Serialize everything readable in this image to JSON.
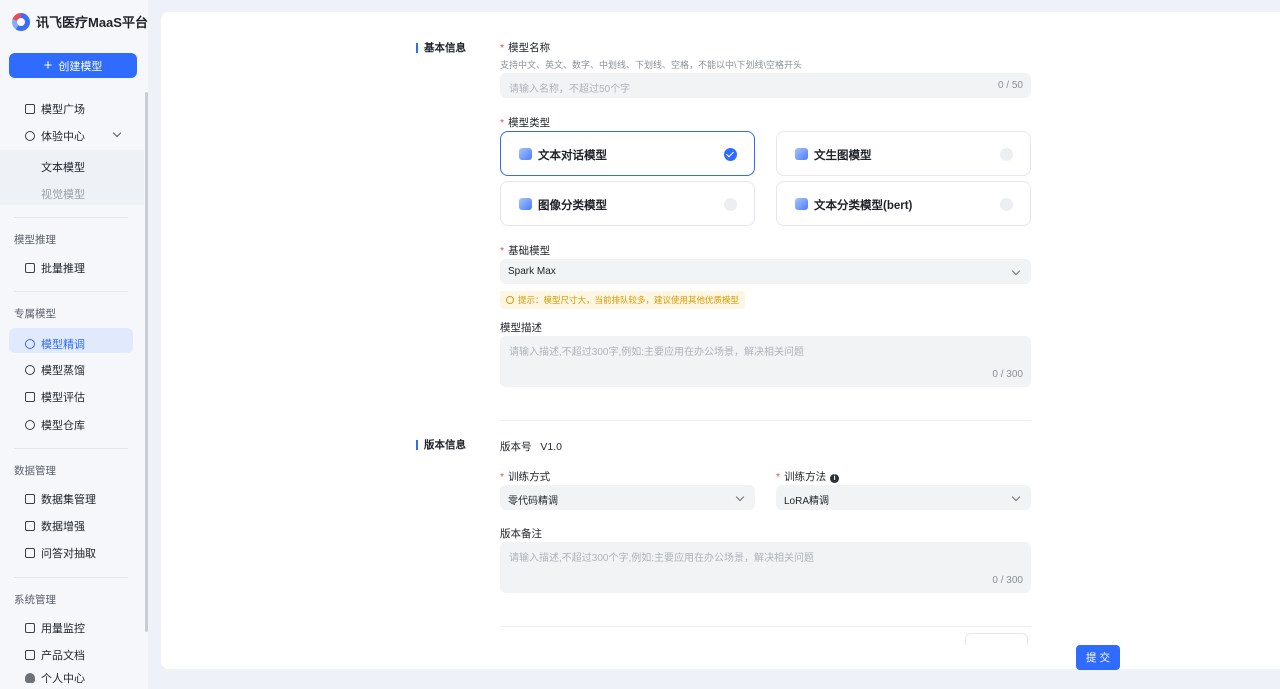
{
  "app": {
    "title": "讯飞医疗MaaS平台"
  },
  "sidebar": {
    "create_button": "创建模型",
    "items": {
      "model_square": "模型广场",
      "experience_center": "体验中心",
      "text_model": "文本模型",
      "vision_model": "视觉模型",
      "batch_inference": "批量推理",
      "model_finetune": "模型精调",
      "model_distill": "模型蒸馏",
      "model_eval": "模型评估",
      "model_repo": "模型仓库",
      "dataset_mgmt": "数据集管理",
      "data_augment": "数据增强",
      "qa_extract": "问答对抽取",
      "usage_monitor": "用量监控",
      "product_docs": "产品文档",
      "personal_center": "个人中心"
    },
    "sections": {
      "inference": "模型推理",
      "exclusive": "专属模型",
      "data": "数据管理",
      "system": "系统管理"
    }
  },
  "form": {
    "basic_section": "基本信息",
    "name_label": "模型名称",
    "name_hint": "支持中文、英文、数字、中划线、下划线、空格，不能以中\\下划线\\空格开头",
    "name_placeholder": "请输入名称，不超过50个字",
    "name_counter": "0 / 50",
    "type_label": "模型类型",
    "types": [
      {
        "label": "文本对话模型",
        "selected": true
      },
      {
        "label": "文生图模型",
        "selected": false
      },
      {
        "label": "图像分类模型",
        "selected": false
      },
      {
        "label": "文本分类模型(bert)",
        "selected": false
      }
    ],
    "base_model_label": "基础模型",
    "base_model_value": "Spark Max",
    "warning": "提示：模型尺寸大，当前排队较多，建议使用其他优质模型",
    "desc_label": "模型描述",
    "desc_placeholder": "请输入描述,不超过300字,例如:主要应用在办公场景，解决相关问题",
    "desc_counter": "0 / 300",
    "version_section": "版本信息",
    "version_label": "版本号",
    "version_value": "V1.0",
    "train_mode_label": "训练方式",
    "train_mode_value": "零代码精调",
    "train_method_label": "训练方法",
    "train_method_value": "LoRA精调",
    "version_note_label": "版本备注",
    "version_note_placeholder": "请输入描述,不超过300个字,例如:主要应用在办公场景，解决相关问题",
    "version_note_counter": "0 / 300",
    "submit": "提 交"
  },
  "colors": {
    "accent": "#2f6bff",
    "warning": "#d99a00",
    "required": "#e34d59"
  }
}
